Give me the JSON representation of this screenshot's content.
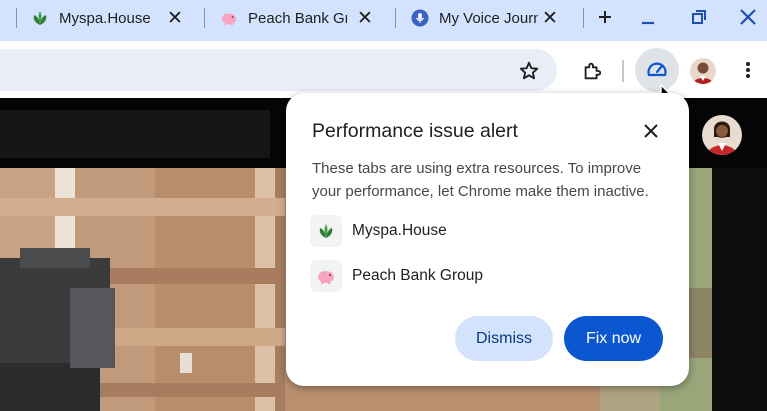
{
  "tabs": [
    {
      "title": "Myspa.House",
      "favicon": "leaf-icon"
    },
    {
      "title": "Peach Bank Gr",
      "favicon": "piggy-bank-icon"
    },
    {
      "title": "My Voice Journ",
      "favicon": "microphone-icon"
    }
  ],
  "toolbar": {
    "icons": [
      "star-icon",
      "extensions-icon",
      "performance-icon",
      "profile-avatar",
      "more-menu-icon"
    ]
  },
  "dialog": {
    "title": "Performance issue alert",
    "description": "These tabs are using extra resources. To improve your performance, let Chrome make them inactive.",
    "items": [
      {
        "label": "Myspa.House",
        "icon": "leaf-icon"
      },
      {
        "label": "Peach Bank Group",
        "icon": "piggy-bank-icon"
      }
    ],
    "dismiss_label": "Dismiss",
    "fix_label": "Fix now"
  },
  "colors": {
    "tabstrip": "#d3e3fd",
    "accent": "#0b57d0",
    "tonal_button": "#d3e3fd"
  }
}
